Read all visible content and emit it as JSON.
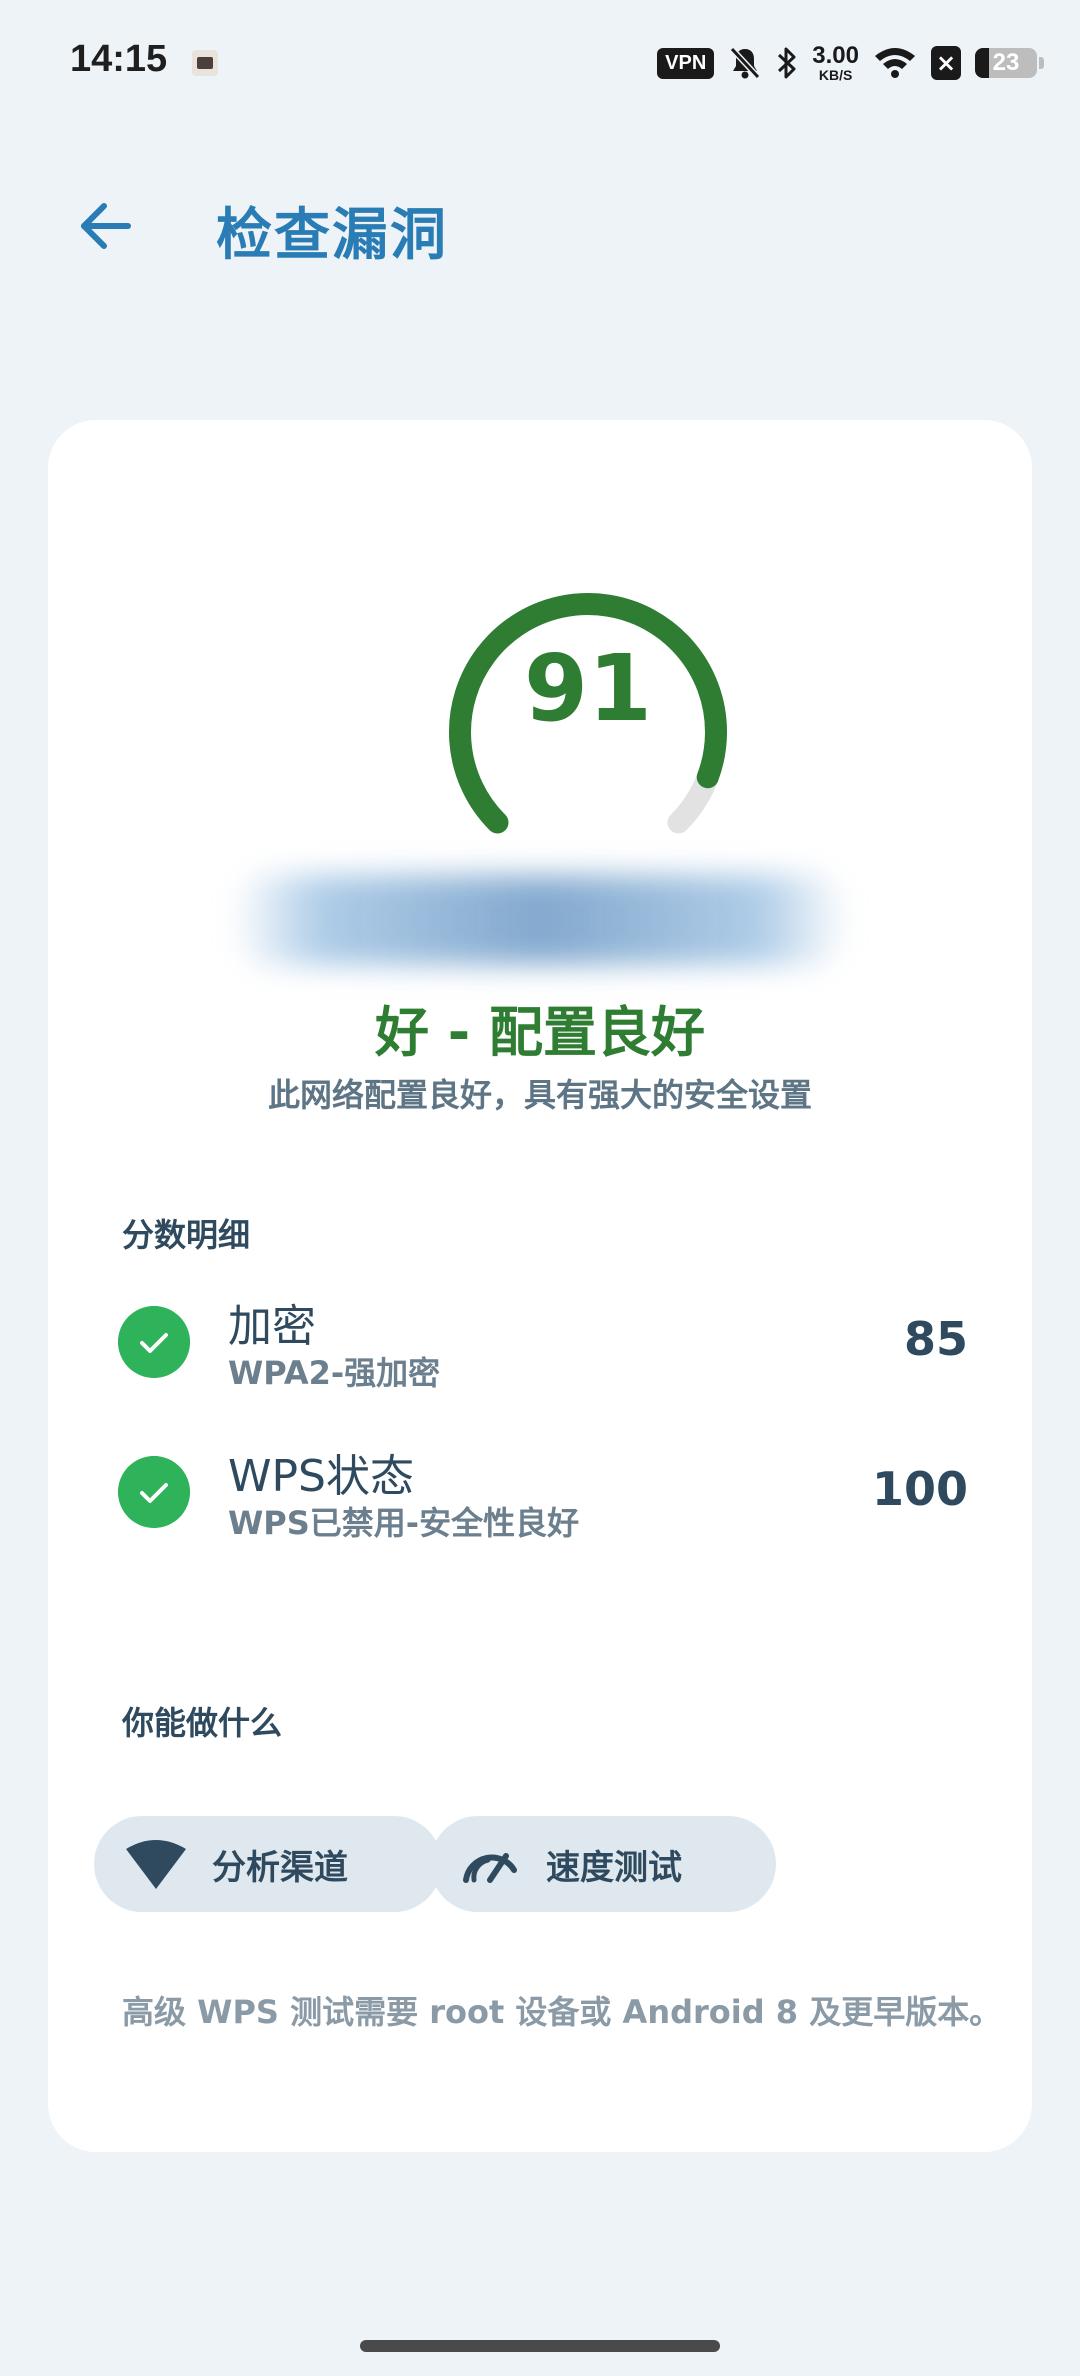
{
  "status_bar": {
    "time": "14:15",
    "vpn_label": "VPN",
    "speed_value": "3.00",
    "speed_unit": "KB/S",
    "battery_level": "23"
  },
  "header": {
    "title": "检查漏洞"
  },
  "score_card": {
    "score": "91",
    "score_fraction": 0.91,
    "rating": "好 - 配置良好",
    "rating_description": "此网络配置良好，具有强大的安全设置",
    "color_good": "#2e7d32"
  },
  "breakdown": {
    "heading": "分数明细",
    "items": [
      {
        "title": "加密",
        "subtitle": "WPA2-强加密",
        "score": "85"
      },
      {
        "title": "WPS状态",
        "subtitle": "WPS已禁用-安全性良好",
        "score": "100"
      }
    ]
  },
  "actions": {
    "heading": "你能做什么",
    "buttons": [
      {
        "label": "分析渠道",
        "icon": "wifi-signal-icon"
      },
      {
        "label": "速度测试",
        "icon": "speedometer-icon"
      }
    ],
    "footnote": "高级 WPS 测试需要 root 设备或 Android 8 及更早版本。"
  }
}
